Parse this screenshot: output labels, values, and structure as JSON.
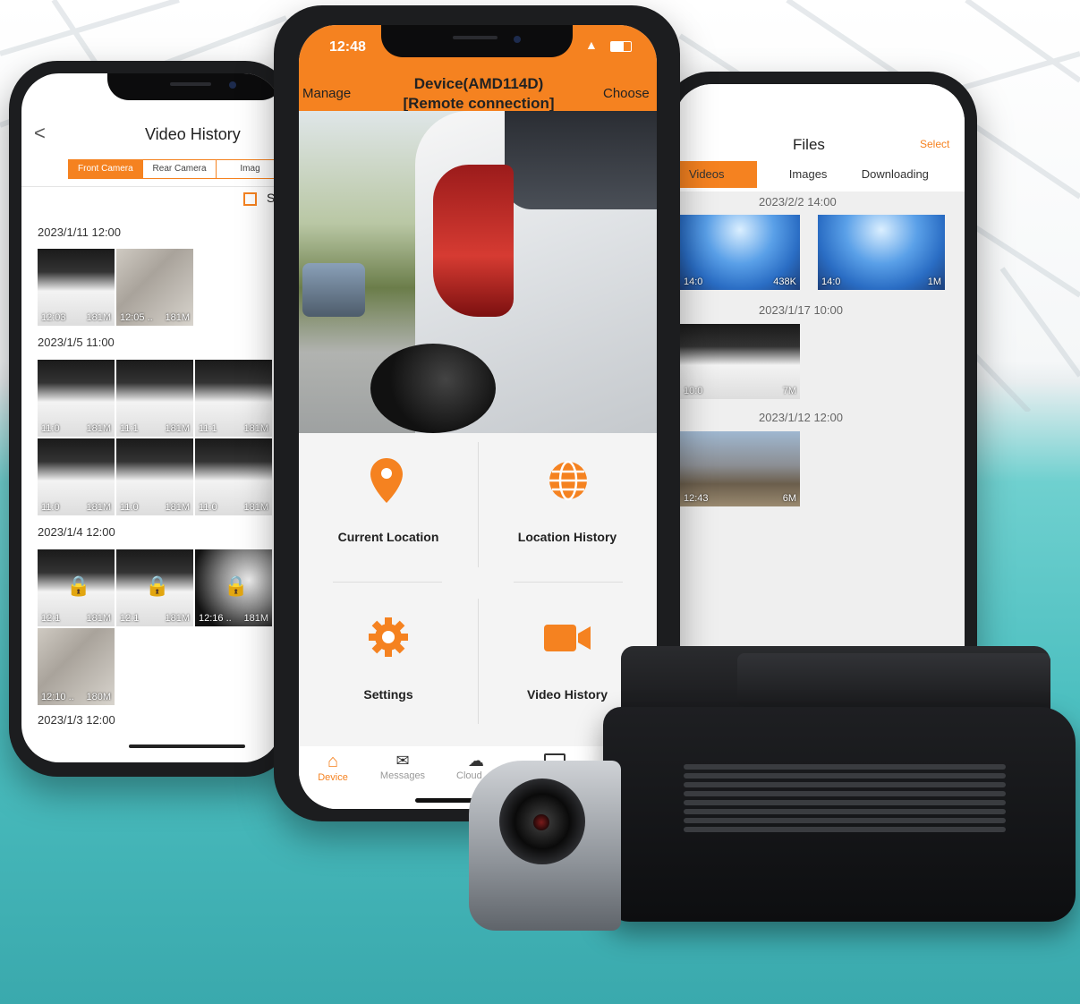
{
  "left_phone": {
    "title": "Video History",
    "back_symbol": "<",
    "tabs": [
      "Front Camera",
      "Rear Camera",
      "Imag"
    ],
    "show_toggle_label": "Sh",
    "sections": [
      {
        "date": "2023/1/11 12:00",
        "thumbs": [
          {
            "time": "12:03",
            "size": "181M"
          },
          {
            "time": "12:05 ..",
            "size": "181M"
          }
        ]
      },
      {
        "date": "2023/1/5 11:00",
        "thumbs": [
          {
            "time": "11:0",
            "size": "181M"
          },
          {
            "time": "11:1",
            "size": "181M"
          },
          {
            "time": "11:1",
            "size": "181M"
          },
          {
            "time": "11:0",
            "size": "181M"
          },
          {
            "time": "11:0",
            "size": "181M"
          },
          {
            "time": "11:0",
            "size": "181M"
          }
        ]
      },
      {
        "date": "2023/1/4 12:00",
        "thumbs": [
          {
            "time": "12:1",
            "size": "181M"
          },
          {
            "time": "12:1",
            "size": "181M"
          },
          {
            "time": "12:16 ..",
            "size": "181M"
          },
          {
            "time": "12:10 ..",
            "size": "180M"
          }
        ]
      },
      {
        "date": "2023/1/3 12:00",
        "thumbs": []
      }
    ]
  },
  "center_phone": {
    "status_time": "12:48",
    "header_left": "Manage",
    "header_title_line1": "Device(AMD114D)",
    "header_title_line2": "[Remote connection]",
    "header_right": "Choose",
    "menu": [
      {
        "label": "Current Location",
        "icon": "location-pin-icon"
      },
      {
        "label": "Location History",
        "icon": "globe-icon"
      },
      {
        "label": "Settings",
        "icon": "gear-icon"
      },
      {
        "label": "Video History",
        "icon": "video-camera-icon"
      }
    ],
    "nav": [
      {
        "label": "Device",
        "icon": "home-icon"
      },
      {
        "label": "Messages",
        "icon": "envelope-icon"
      },
      {
        "label": "Cloud",
        "icon": "cloud-icon"
      },
      {
        "label": "",
        "icon": "folder-icon"
      }
    ],
    "accent": "#f58220"
  },
  "right_phone": {
    "title": "Files",
    "select_label": "Select",
    "tabs": [
      "Videos",
      "Images",
      "Downloading"
    ],
    "sections": [
      {
        "date": "2023/2/2 14:00",
        "thumbs": [
          {
            "time": "14:0",
            "size": "438K"
          },
          {
            "time": "14:0",
            "size": "1M"
          }
        ]
      },
      {
        "date": "2023/1/17 10:00",
        "thumbs": [
          {
            "time": "10:0",
            "size": "7M"
          }
        ]
      },
      {
        "date": "2023/1/12 12:00",
        "thumbs": [
          {
            "time": "12:43",
            "size": "6M"
          }
        ]
      }
    ]
  }
}
